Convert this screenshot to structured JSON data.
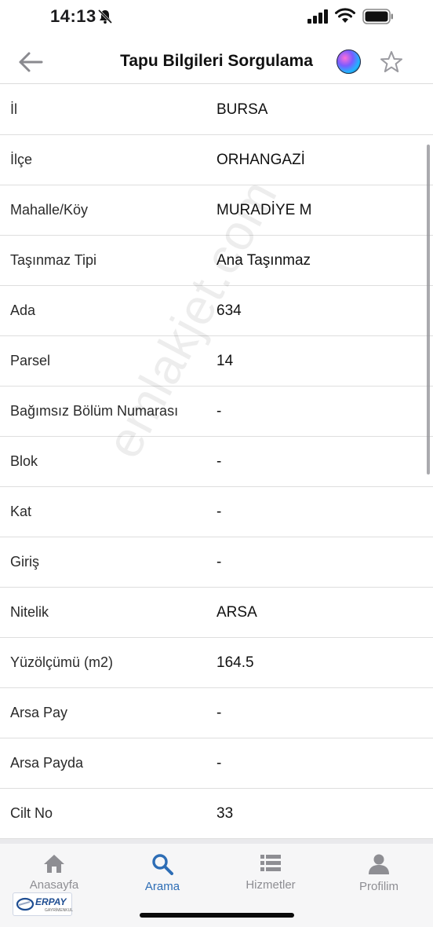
{
  "status_bar": {
    "time": "14:13"
  },
  "nav": {
    "title": "Tapu Bilgileri Sorgulama",
    "back_icon": "arrow-left-icon",
    "star_icon": "star-outline-icon"
  },
  "rows": [
    {
      "label": "İl",
      "value": "BURSA"
    },
    {
      "label": "İlçe",
      "value": "ORHANGAZİ"
    },
    {
      "label": "Mahalle/Köy",
      "value": "MURADİYE M"
    },
    {
      "label": "Taşınmaz Tipi",
      "value": "Ana Taşınmaz"
    },
    {
      "label": "Ada",
      "value": "634"
    },
    {
      "label": "Parsel",
      "value": "14"
    },
    {
      "label": "Bağımsız Bölüm Numarası",
      "value": "-"
    },
    {
      "label": "Blok",
      "value": "-"
    },
    {
      "label": "Kat",
      "value": "-"
    },
    {
      "label": "Giriş",
      "value": "-"
    },
    {
      "label": "Nitelik",
      "value": "ARSA"
    },
    {
      "label": "Yüzölçümü (m2)",
      "value": "164.5"
    },
    {
      "label": "Arsa Pay",
      "value": "-"
    },
    {
      "label": "Arsa Payda",
      "value": "-"
    },
    {
      "label": "Cilt No",
      "value": "33"
    }
  ],
  "watermark": "emlakjet.com",
  "tabs": [
    {
      "label": "Anasayfa",
      "icon": "home-icon",
      "active": false
    },
    {
      "label": "Arama",
      "icon": "search-icon",
      "active": true
    },
    {
      "label": "Hizmetler",
      "icon": "list-icon",
      "active": false
    },
    {
      "label": "Profilim",
      "icon": "user-icon",
      "active": false
    }
  ],
  "brand_logo": {
    "name": "ERPAY",
    "sub": "GAYRİMENKUL"
  },
  "colors": {
    "accent": "#2d6db5",
    "inactive": "#8e8e93",
    "divider": "#dedede"
  }
}
